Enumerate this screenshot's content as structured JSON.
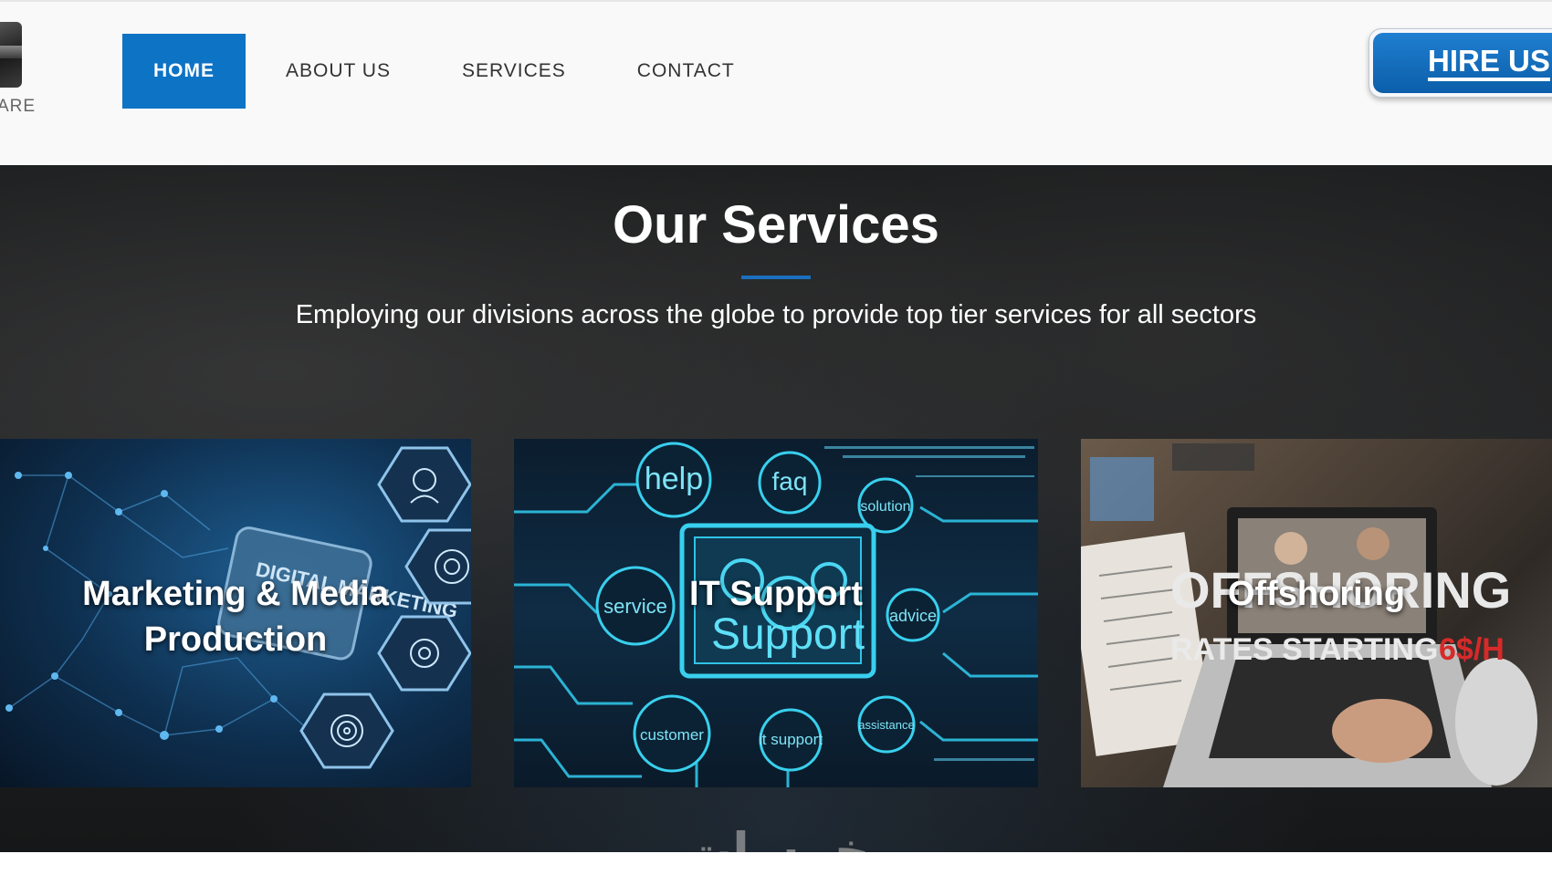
{
  "header": {
    "logo_text": "ARE",
    "nav": [
      {
        "label": "HOME",
        "active": true
      },
      {
        "label": "ABOUT US",
        "active": false
      },
      {
        "label": "SERVICES",
        "active": false
      },
      {
        "label": "CONTACT",
        "active": false
      }
    ],
    "hire_button": "HIRE US"
  },
  "services": {
    "title": "Our Services",
    "subtitle": "Employing our divisions across the globe to provide top tier services for all sectors",
    "cards": [
      {
        "label": "Marketing & Media Production",
        "image_text": "DIGITAL MARKETING"
      },
      {
        "label": "IT Support",
        "image_text": "Support",
        "bubbles": [
          "help",
          "faq",
          "solution",
          "service",
          "advice",
          "customer",
          "it support",
          "assistance"
        ]
      },
      {
        "label": "Offshoring",
        "image_text": "OFFSHORING",
        "rates_text": "RATES STARTING",
        "rates_value": "6$/H"
      }
    ]
  },
  "watermark": "خمسات",
  "colors": {
    "accent": "#0d73c5",
    "title_rule": "#1a6fbe",
    "rates_red": "#d62a2a",
    "circuit": "#34c6e8"
  }
}
